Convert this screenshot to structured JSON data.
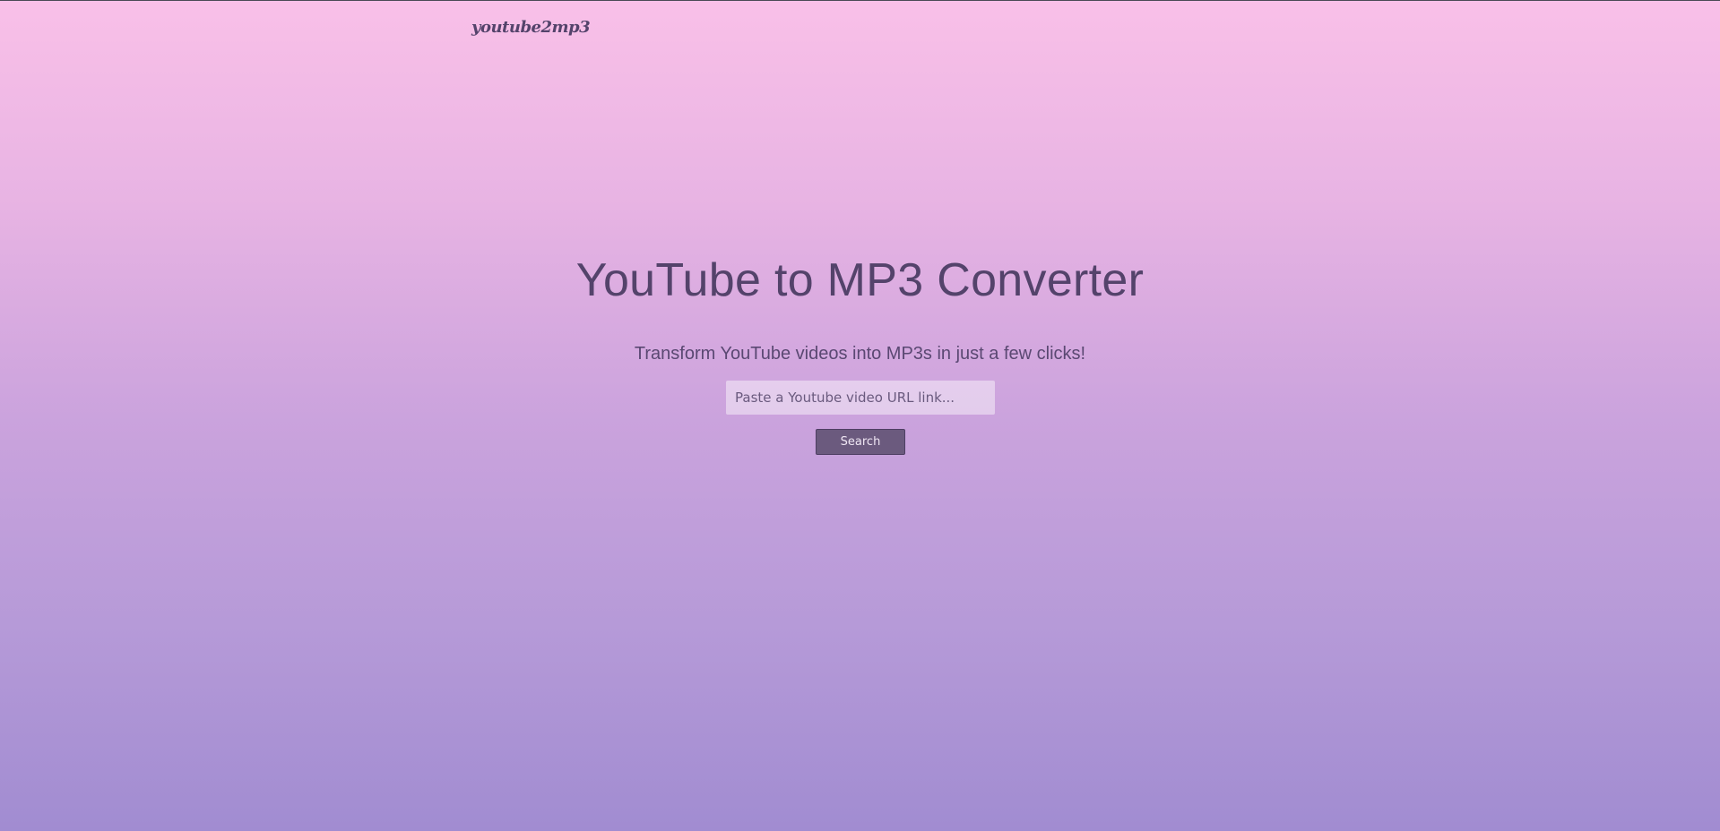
{
  "header": {
    "logo_text": "youtube2mp3"
  },
  "hero": {
    "title": "YouTube to MP3 Converter",
    "subtitle": "Transform YouTube videos into MP3s in just a few clicks!"
  },
  "search": {
    "placeholder": "Paste a Youtube video URL link...",
    "value": "",
    "button_label": "Search"
  },
  "colors": {
    "gradient_top": "#f9c0e8",
    "gradient_bottom": "#a18cd1",
    "text": "#54436b",
    "button_bg": "#6b5a7e"
  }
}
